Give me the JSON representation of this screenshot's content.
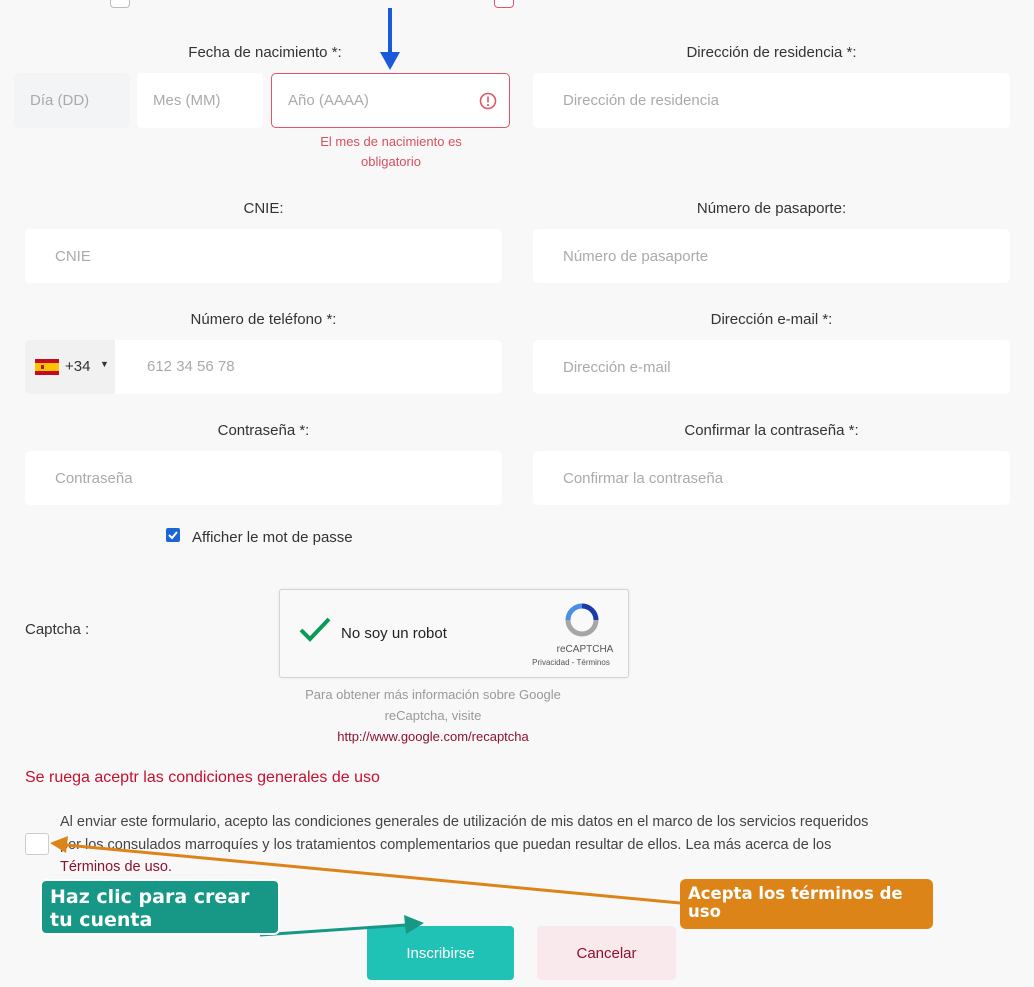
{
  "birth": {
    "label": "Fecha de nacimiento *:",
    "day_placeholder": "Día (DD)",
    "month_placeholder": "Mes (MM)",
    "year_placeholder": "Año (AAAA)",
    "error": "El mes de nacimiento es obligatorio"
  },
  "address": {
    "label": "Dirección de residencia *:",
    "placeholder": "Dirección de residencia"
  },
  "cnie": {
    "label": "CNIE:",
    "placeholder": "CNIE"
  },
  "passport": {
    "label": "Número de pasaporte:",
    "placeholder": "Número de pasaporte"
  },
  "phone": {
    "label": "Número de teléfono *:",
    "country_code": "+34",
    "placeholder": "612 34 56 78",
    "flag": "spain-flag-icon"
  },
  "email": {
    "label": "Dirección e-mail *:",
    "placeholder": "Dirección e-mail"
  },
  "password": {
    "label": "Contraseña *:",
    "placeholder": "Contraseña"
  },
  "confirm_password": {
    "label": "Confirmar la contraseña *:",
    "placeholder": "Confirmar la contraseña"
  },
  "show_password": {
    "label": "Afficher le mot de passe",
    "checked": true
  },
  "captcha": {
    "label": "Captcha :",
    "checkbox_label": "No soy un robot",
    "brand": "reCAPTCHA",
    "links": "Privacidad - Términos",
    "info_line1": "Para obtener más información sobre Google",
    "info_line2": "reCaptcha, visite",
    "info_link": "http://www.google.com/recaptcha"
  },
  "terms": {
    "warning": "Se ruega aceptr las condiciones generales de uso",
    "text_line1": "Al enviar este formulario, acepto las condiciones generales de utilización de mis datos en el marco de los servicios requeridos",
    "text_line2": "por los consulados marroquíes y los tratamientos complementarios que puedan resultar de ellos. Lea más acerca de los",
    "link": "Términos de uso."
  },
  "buttons": {
    "submit": "Inscribirse",
    "cancel": "Cancelar"
  },
  "annotations": {
    "create_account": "Haz clic para crear tu cuenta",
    "accept_terms": "Acepta los términos de uso"
  },
  "colors": {
    "error": "#e05565",
    "submit": "#1fc2b5",
    "callout_teal": "#179886",
    "callout_orange": "#dd8418",
    "arrow_blue": "#1a5ad8",
    "warning_red": "#c8102e"
  }
}
